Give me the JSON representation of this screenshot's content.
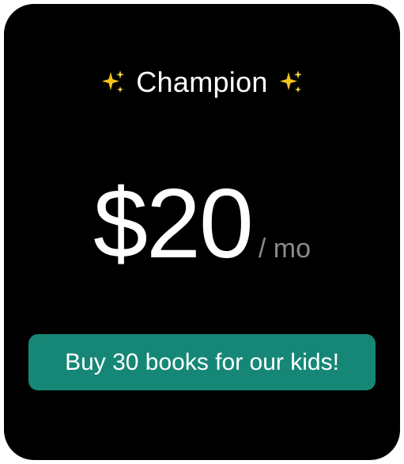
{
  "plan": {
    "name": "Champion",
    "left_icon": "sparkles-icon",
    "right_icon": "sparkles-icon"
  },
  "pricing": {
    "price": "$20",
    "period": "/ mo"
  },
  "cta": {
    "label": "Buy 30 books for our kids!"
  },
  "colors": {
    "card_background": "#000000",
    "button_background": "#168777",
    "text_primary": "#ffffff",
    "text_muted": "#8a8a8a",
    "sparkle": "#f5c518"
  }
}
